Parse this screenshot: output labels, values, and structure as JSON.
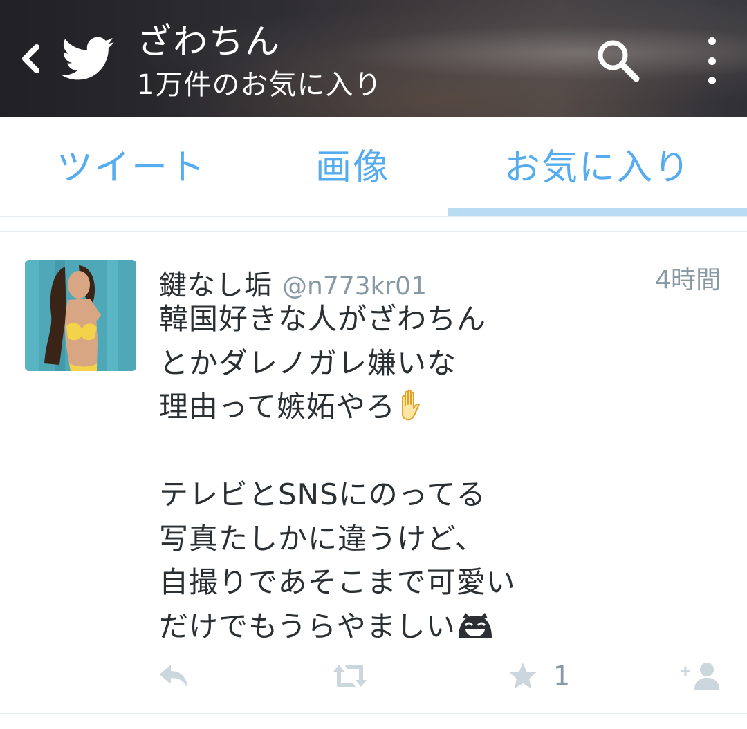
{
  "header": {
    "title": "ざわちん",
    "subtitle": "1万件のお気に入り",
    "icons": {
      "back": "chevron-left-icon",
      "logo": "twitter-bird-icon",
      "search": "search-icon",
      "more": "more-vertical-icon"
    }
  },
  "tabs": [
    {
      "label": "ツイート",
      "active": false
    },
    {
      "label": "画像",
      "active": false
    },
    {
      "label": "お気に入り",
      "active": true
    }
  ],
  "tweet": {
    "display_name": "鍵なし垢",
    "handle": "@n773kr01",
    "time": "4時間",
    "lines": [
      "韓国好きな人がざわちん",
      "とかダレノガレ嫌いな",
      "理由って嫉妬やろ",
      "",
      "テレビとSNSにのってる",
      "写真たしかに違うけど、",
      "自撮りであそこまで可愛い",
      "だけでもうらやましい"
    ],
    "emojis": {
      "line3": "raised-hand-emoji",
      "line8": "grinning-face-emoji"
    },
    "favorite_count": "1",
    "action_icons": [
      "reply-icon",
      "retweet-icon",
      "star-icon",
      "follow-icon"
    ]
  },
  "colors": {
    "accent": "#55acee",
    "tab_indicator": "#b9dcf3",
    "text": "#292f33",
    "muted": "#8899a6",
    "divider": "#e6ecf0"
  }
}
